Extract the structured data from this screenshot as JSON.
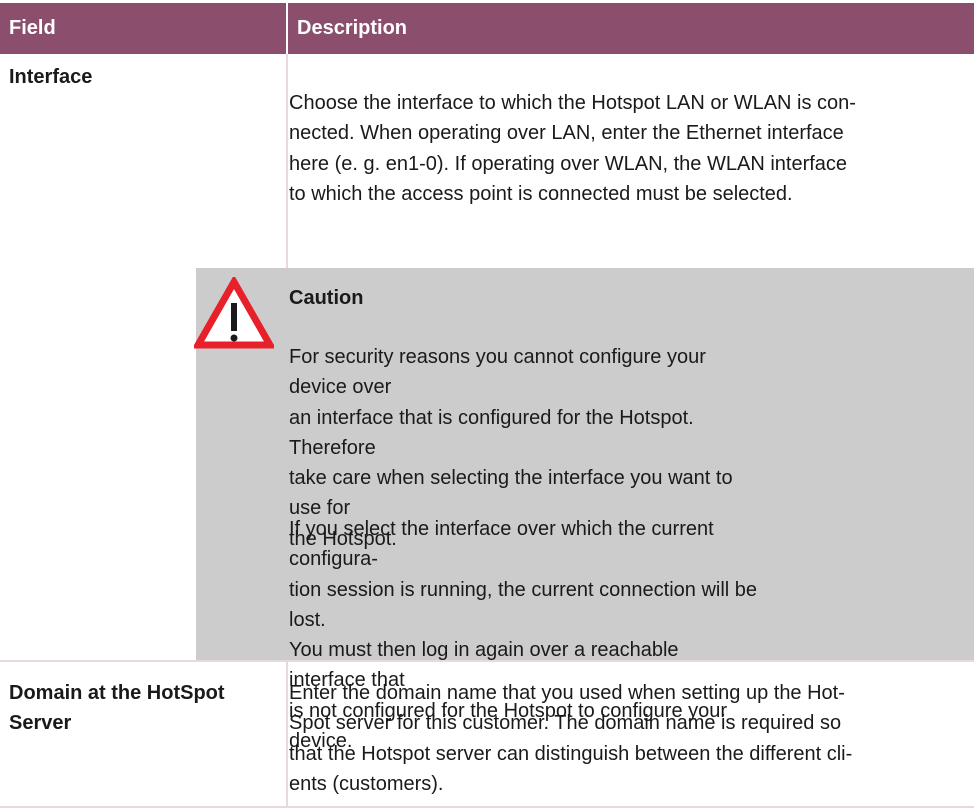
{
  "header": {
    "field": "Field",
    "description": "Description"
  },
  "rows": [
    {
      "field": "Interface",
      "description": "Choose the interface to which the Hotspot LAN or WLAN is con-\nnected. When operating over LAN, enter the Ethernet interface\nhere (e. g. en1-0). If operating over WLAN, the WLAN interface\nto which the access point is connected must be selected."
    },
    {
      "field": "Domain at the HotSpot\nServer",
      "description": "Enter the domain name that you used when setting up the Hot-\nSpot server for this customer. The domain name is required so\nthat the Hotspot server can distinguish between the different cli-\nents (customers)."
    }
  ],
  "caution": {
    "title": "Caution",
    "paragraph1": "For security reasons you cannot configure your device over\nan interface that is configured for the Hotspot. Therefore\ntake care when selecting the interface you want to use for\nthe Hotspot.",
    "paragraph2": "If you select the interface over which the current configura-\ntion session is running, the current connection will be lost.\nYou must then log in again over a reachable interface that\nis not configured for the Hotspot to configure your device.",
    "icon": "warning-triangle-icon",
    "icon_color": "#e8202a"
  },
  "colors": {
    "header_bg": "#8c4e6d",
    "grid_line": "#e8d8e1",
    "caution_bg": "#cccccc"
  }
}
